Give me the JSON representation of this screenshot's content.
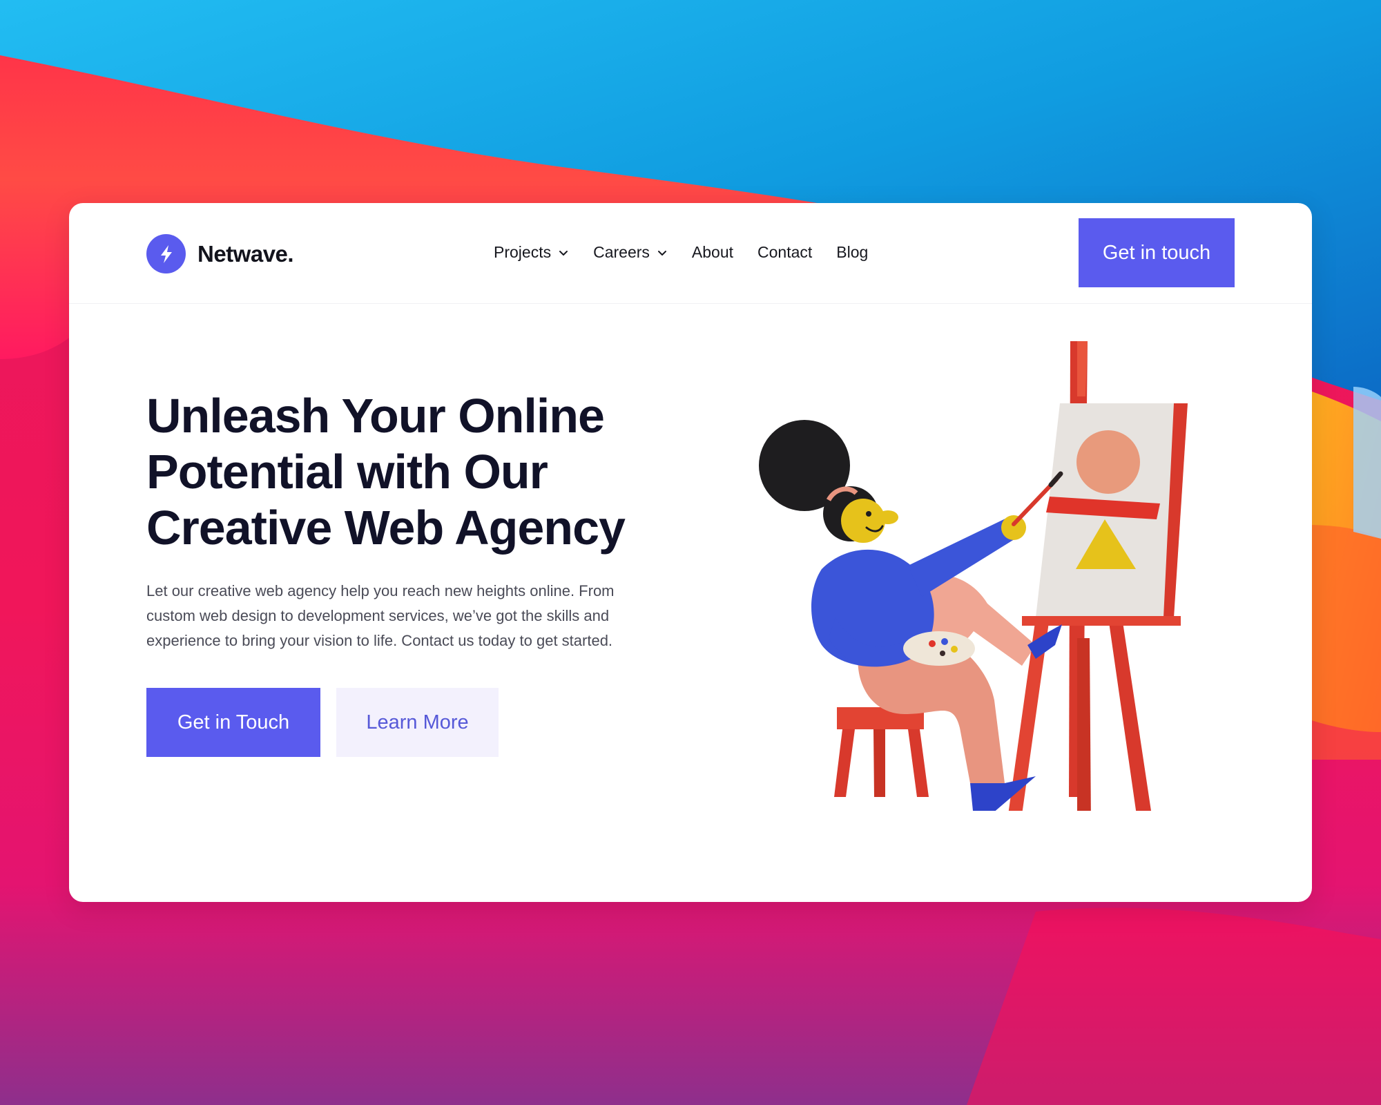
{
  "brand": {
    "name": "Netwave.",
    "logo_icon": "lightning-bolt-icon",
    "color": "#5a5bee"
  },
  "nav": {
    "items": [
      {
        "label": "Projects",
        "has_dropdown": true
      },
      {
        "label": "Careers",
        "has_dropdown": true
      },
      {
        "label": "About",
        "has_dropdown": false
      },
      {
        "label": "Contact",
        "has_dropdown": false
      },
      {
        "label": "Blog",
        "has_dropdown": false
      }
    ],
    "cta_label": "Get in touch"
  },
  "hero": {
    "title_lines": [
      "Unleash Your Online",
      "Potential with Our",
      "Creative Web Agency"
    ],
    "description_lines": [
      "Let our creative web agency help you reach new heights online. From",
      "custom web design to development services, we’ve got the skills and",
      "experience to bring your vision to life. Contact us today to get started."
    ],
    "primary_button": "Get in Touch",
    "secondary_button": "Learn More",
    "illustration": "artist-painting-at-easel-illustration"
  },
  "colors": {
    "accent": "#5a5bee",
    "secondary_bg": "#f3f1fd",
    "secondary_text": "#5659d8",
    "heading": "#111228",
    "body_text": "#4a4b57"
  }
}
